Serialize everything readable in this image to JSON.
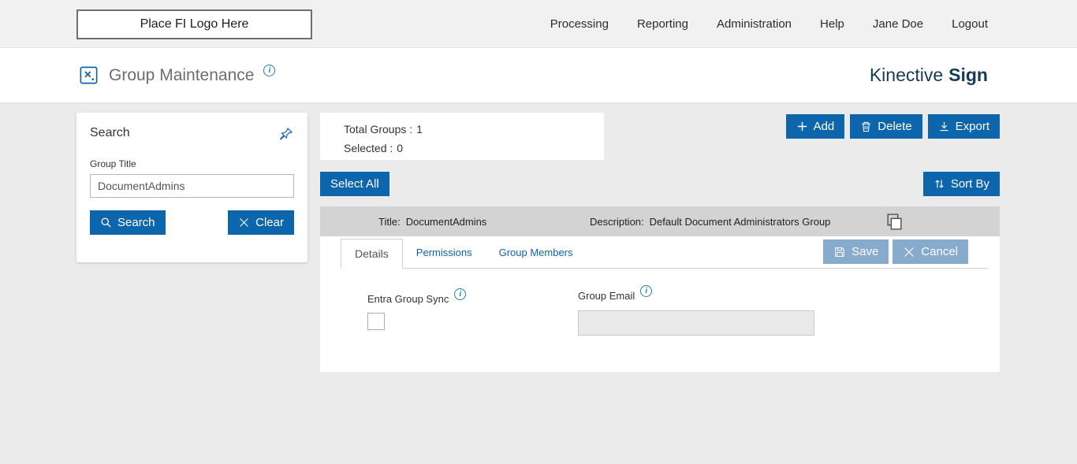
{
  "colors": {
    "primary_blue": "#0d65ab",
    "muted_blue": "#86abcd",
    "brand_navy": "#143c55",
    "row_gray": "#d4d3d3"
  },
  "header": {
    "logo_placeholder": "Place FI Logo Here",
    "nav": [
      {
        "label": "Processing"
      },
      {
        "label": "Reporting"
      },
      {
        "label": "Administration"
      },
      {
        "label": "Help"
      },
      {
        "label": "Jane Doe"
      },
      {
        "label": "Logout"
      }
    ]
  },
  "page": {
    "title": "Group Maintenance",
    "brand_name": "Kinective",
    "brand_product": "Sign"
  },
  "search_panel": {
    "title": "Search",
    "group_title_label": "Group Title",
    "group_title_value": "DocumentAdmins",
    "search_button": "Search",
    "clear_button": "Clear"
  },
  "summary": {
    "total_groups_label": "Total Groups :",
    "total_groups_value": "1",
    "selected_label": "Selected :",
    "selected_value": "0"
  },
  "toolbar": {
    "add": "Add",
    "delete": "Delete",
    "export": "Export",
    "select_all": "Select All",
    "sort_by": "Sort By"
  },
  "group_row": {
    "title_label": "Title:",
    "title_value": "DocumentAdmins",
    "description_label": "Description:",
    "description_value": "Default Document Administrators Group"
  },
  "detail": {
    "tabs": [
      {
        "label": "Details"
      },
      {
        "label": "Permissions"
      },
      {
        "label": "Group Members"
      }
    ],
    "save_button": "Save",
    "cancel_button": "Cancel",
    "entra_group_sync_label": "Entra Group Sync",
    "group_email_label": "Group Email",
    "group_email_value": ""
  }
}
